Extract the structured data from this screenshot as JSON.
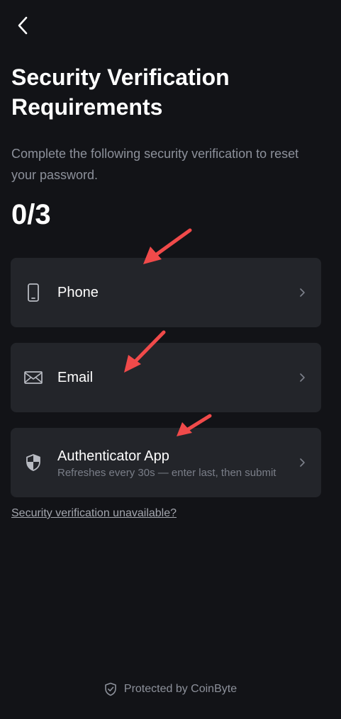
{
  "header": {
    "back_icon": "chevron-left-icon"
  },
  "title": "Security Verification Requirements",
  "subtitle": "Complete the following security verification to reset your password.",
  "progress": {
    "text": "0/3",
    "completed": 0,
    "total": 3
  },
  "options": [
    {
      "label": "Phone",
      "icon": "phone-icon"
    },
    {
      "label": "Email",
      "icon": "mail-icon"
    },
    {
      "label": "Authenticator App",
      "description": "Refreshes every 30s — enter last, then submit",
      "icon": "shield-icon"
    }
  ],
  "unavailable_link": "Security verification unavailable?",
  "footer": {
    "text": "Protected by CoinByte",
    "icon": "shield-check-icon"
  },
  "colors": {
    "background": "#121317",
    "card": "#23252a",
    "annotation_arrow": "#f04a4a"
  }
}
